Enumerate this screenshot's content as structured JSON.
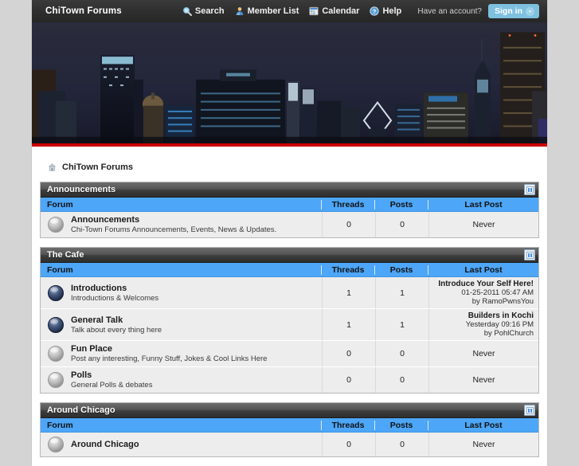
{
  "header": {
    "site_title": "ChiTown Forums",
    "nav": [
      {
        "label": "Search",
        "icon": "search-icon"
      },
      {
        "label": "Member List",
        "icon": "member-list-icon"
      },
      {
        "label": "Calendar",
        "icon": "calendar-icon"
      },
      {
        "label": "Help",
        "icon": "help-icon"
      }
    ],
    "account_prompt": "Have an account?",
    "signin_label": "Sign in",
    "signin_bg": "#7ec0e0",
    "bar_bg": "#2f2f2f"
  },
  "banner": {
    "alt": "Chicago night skyline",
    "accent_stripe": "#cc0000"
  },
  "breadcrumb": {
    "icon": "home-icon",
    "label": "ChiTown Forums"
  },
  "columns": {
    "forum": "Forum",
    "threads": "Threads",
    "posts": "Posts",
    "last_post": "Last Post"
  },
  "colors": {
    "column_header": "#4da6f7",
    "category_header": "#3d3d3d",
    "row_bg": "#ededed"
  },
  "categories": [
    {
      "title": "Announcements",
      "collapse_icon": "collapse-icon",
      "forums": [
        {
          "name": "Announcements",
          "description": "Chi-Town Forums Announcements, Events, News & Updates.",
          "status_icon": "forum-no-new-posts-icon",
          "threads": "0",
          "posts": "0",
          "last_post": {
            "never": "Never"
          }
        }
      ]
    },
    {
      "title": "The Cafe",
      "collapse_icon": "collapse-icon",
      "forums": [
        {
          "name": "Introductions",
          "description": "Introductions & Welcomes",
          "status_icon": "forum-new-posts-icon",
          "threads": "1",
          "posts": "1",
          "last_post": {
            "title": "Introduce Your Self Here!",
            "date": "01-25-2011 05:47 AM",
            "by": "by RamoPwnsYou"
          }
        },
        {
          "name": "General Talk",
          "description": "Talk about every thing here",
          "status_icon": "forum-new-posts-icon",
          "threads": "1",
          "posts": "1",
          "last_post": {
            "title": "Builders in Kochi",
            "date": "Yesterday 09:16 PM",
            "by": "by PohlChurch"
          }
        },
        {
          "name": "Fun Place",
          "description": "Post any interesting, Funny Stuff, Jokes & Cool Links Here",
          "status_icon": "forum-no-new-posts-icon",
          "threads": "0",
          "posts": "0",
          "last_post": {
            "never": "Never"
          }
        },
        {
          "name": "Polls",
          "description": "General Polls & debates",
          "status_icon": "forum-no-new-posts-icon",
          "threads": "0",
          "posts": "0",
          "last_post": {
            "never": "Never"
          }
        }
      ]
    },
    {
      "title": "Around Chicago",
      "collapse_icon": "collapse-icon",
      "forums": [
        {
          "name": "Around Chicago",
          "description": "",
          "status_icon": "forum-no-new-posts-icon",
          "threads": "0",
          "posts": "0",
          "last_post": {
            "never": "Never"
          }
        }
      ]
    }
  ]
}
